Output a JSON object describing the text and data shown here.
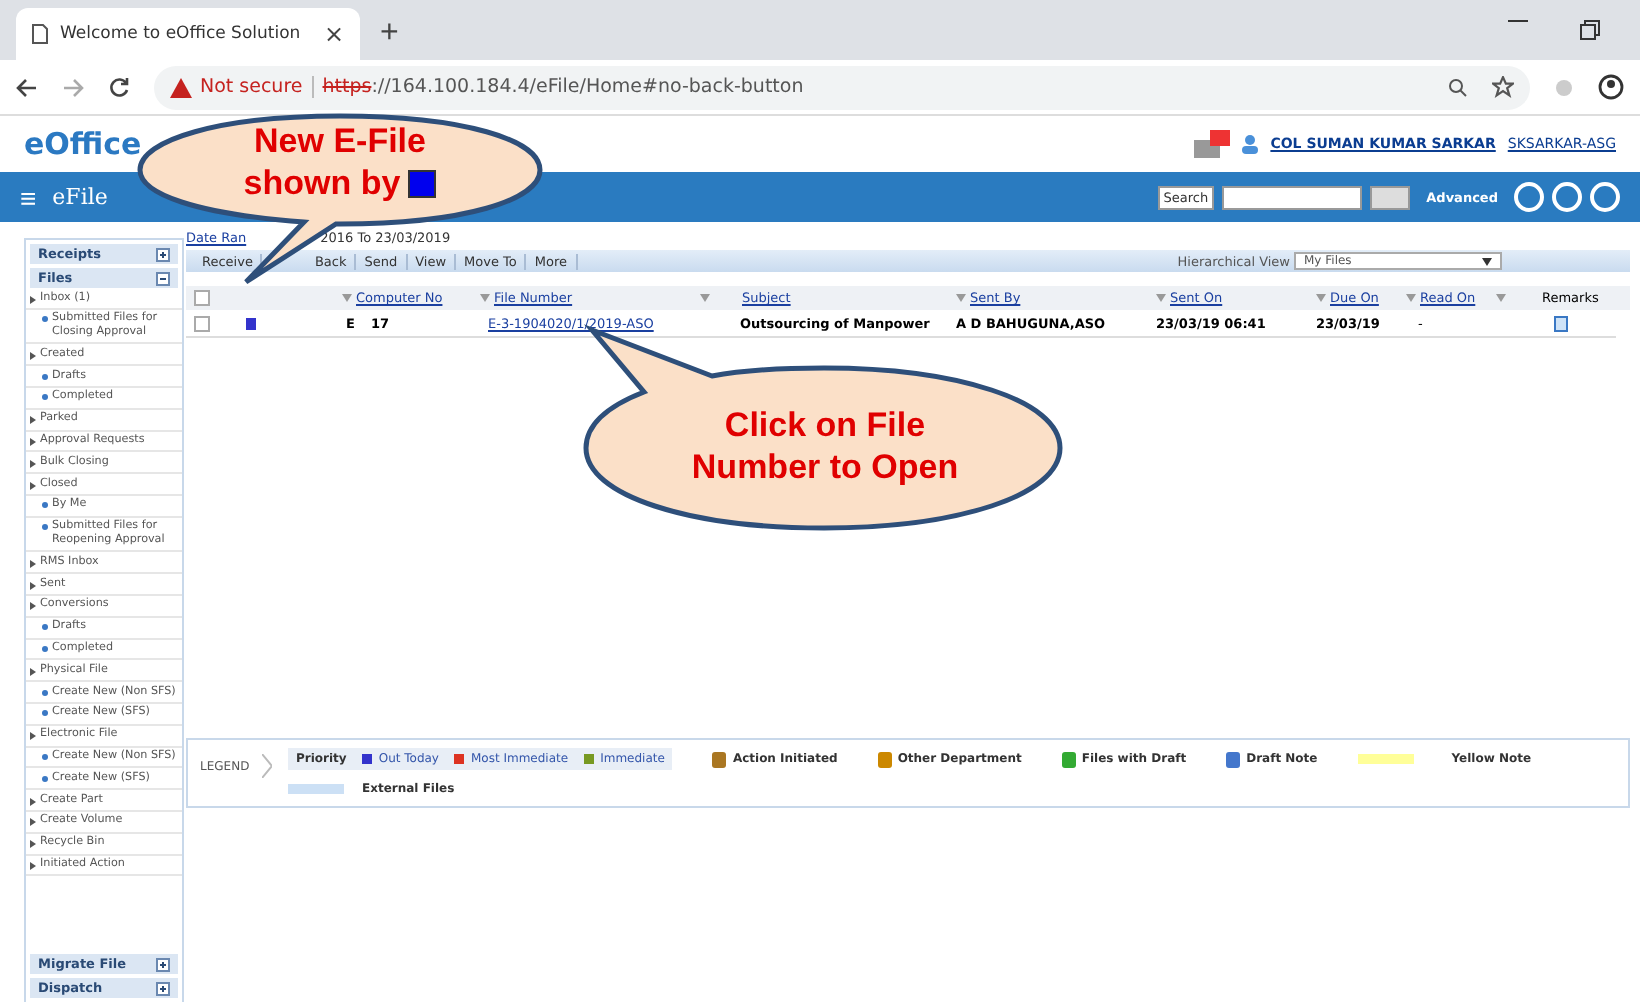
{
  "browser": {
    "tab_title": "Welcome to eOffice Solution",
    "tab_close": "×",
    "new_tab": "+",
    "warning": "Not secure",
    "scheme": "https",
    "url_rest": "://164.100.184.4/eFile/Home#no-back-button"
  },
  "header": {
    "logo": "eOffice",
    "user_name": "COL SUMAN KUMAR SARKAR",
    "user_id": "SKSARKAR-ASG"
  },
  "nav": {
    "menu": "≡",
    "title": "eFile",
    "search_label": "Search",
    "advanced": "Advanced"
  },
  "sidebar": {
    "sections": [
      {
        "label": "Receipts",
        "expanded": false
      },
      {
        "label": "Files",
        "expanded": true,
        "items": [
          {
            "label": "Inbox (1)",
            "children": [
              {
                "label": "Submitted Files for Closing Approval"
              }
            ]
          },
          {
            "label": "Created",
            "children": [
              {
                "label": "Drafts"
              },
              {
                "label": "Completed"
              }
            ]
          },
          {
            "label": "Parked"
          },
          {
            "label": "Approval Requests"
          },
          {
            "label": "Bulk Closing"
          },
          {
            "label": "Closed",
            "children": [
              {
                "label": "By Me"
              },
              {
                "label": "Submitted Files for Reopening Approval"
              }
            ]
          },
          {
            "label": "RMS Inbox"
          },
          {
            "label": "Sent"
          },
          {
            "label": "Conversions",
            "children": [
              {
                "label": "Drafts"
              },
              {
                "label": "Completed"
              }
            ]
          },
          {
            "label": "Physical File",
            "children": [
              {
                "label": "Create New (Non SFS)"
              },
              {
                "label": "Create New (SFS)"
              }
            ]
          },
          {
            "label": "Electronic File",
            "children": [
              {
                "label": "Create New (Non SFS)"
              },
              {
                "label": "Create New (SFS)"
              }
            ]
          },
          {
            "label": "Create Part"
          },
          {
            "label": "Create Volume"
          },
          {
            "label": "Recycle Bin"
          },
          {
            "label": "Initiated Action"
          }
        ]
      },
      {
        "label": "Migrate File",
        "expanded": false
      },
      {
        "label": "Dispatch",
        "expanded": false
      }
    ]
  },
  "date_range": {
    "label": "Date Ran",
    "value": "2016 To 23/03/2019"
  },
  "toolbar": {
    "buttons": [
      "Receive",
      "Back",
      "Send",
      "View",
      "Move To",
      "More"
    ],
    "view_label": "Hierarchical View",
    "view_value": "My Files"
  },
  "table": {
    "select_all_checked": false,
    "columns": [
      {
        "label": "Computer No",
        "sortable": true
      },
      {
        "label": "File Number",
        "sortable": true
      },
      {
        "label": "Subject",
        "sortable": true
      },
      {
        "label": "Sent By",
        "sortable": true
      },
      {
        "label": "Sent On",
        "sortable": true
      },
      {
        "label": "Due On",
        "sortable": true
      },
      {
        "label": "Read On",
        "sortable": true
      },
      {
        "label": "Remarks",
        "sortable": false
      }
    ],
    "rows": [
      {
        "checked": false,
        "color": "#3333cc",
        "type": "E",
        "computer_no": "17",
        "file_number": "E-3-1904020/1/2019-ASO",
        "subject": "Outsourcing of Manpower",
        "sent_by": "A D BAHUGUNA,ASO",
        "sent_on": "23/03/19 06:41",
        "due_on": "23/03/19",
        "read_on": "-"
      }
    ]
  },
  "legend": {
    "title": "LEGEND",
    "priority_label": "Priority",
    "items": [
      {
        "kind": "swatch",
        "label": "Out Today",
        "color": "#3333cc"
      },
      {
        "kind": "swatch",
        "label": "Most Immediate",
        "color": "#dd3322"
      },
      {
        "kind": "swatch",
        "label": "Immediate",
        "color": "#779922"
      },
      {
        "kind": "icon",
        "label": "Action Initiated",
        "color": "#aa7722"
      },
      {
        "kind": "icon",
        "label": "Other Department",
        "color": "#cc8800"
      },
      {
        "kind": "icon",
        "label": "Files with Draft",
        "color": "#33aa33"
      },
      {
        "kind": "icon",
        "label": "Draft Note",
        "color": "#4477cc"
      },
      {
        "kind": "bar",
        "label": "Yellow Note",
        "color": "#ffff99"
      },
      {
        "kind": "bar",
        "label": "External Files",
        "color": "#cce0f5"
      }
    ]
  },
  "callouts": [
    {
      "lines": [
        "New E-File",
        "shown by"
      ],
      "color": "#0000ee"
    },
    {
      "lines": [
        "Click on File",
        "Number to Open"
      ]
    }
  ]
}
